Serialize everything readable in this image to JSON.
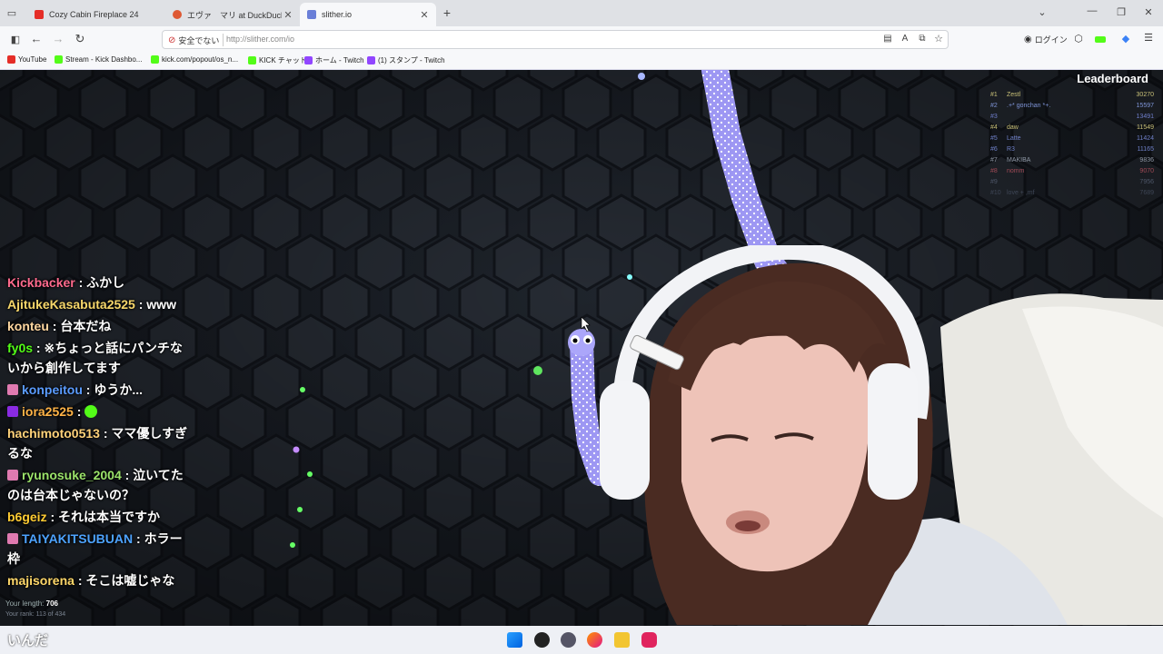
{
  "browser": {
    "tabs": [
      {
        "title": "Cozy Cabin Fireplace 24",
        "favicon": "youtube-icon",
        "color": "#e52d27",
        "active": false
      },
      {
        "title": "エヴァ　マリ at DuckDuckGo",
        "favicon": "duckduckgo-icon",
        "color": "#de5833",
        "active": false
      },
      {
        "title": "slither.io",
        "favicon": "slither-icon",
        "color": "#6a7fd8",
        "active": true
      }
    ],
    "new_tab": "+",
    "insecure_label": "安全でない",
    "url": "http://slither.com/io",
    "login_label": "ログイン",
    "bookmarks": [
      {
        "label": "YouTube",
        "icon": "youtube-icon",
        "color": "#e52d27"
      },
      {
        "label": "Stream - Kick Dashbo...",
        "icon": "kick-icon",
        "color": "#53fc18"
      },
      {
        "label": "kick.com/popout/os_n...",
        "icon": "kick-icon",
        "color": "#53fc18"
      },
      {
        "label": "KICK チャット",
        "icon": "kick-icon",
        "color": "#53fc18"
      },
      {
        "label": "ホーム - Twitch",
        "icon": "twitch-icon",
        "color": "#9146ff"
      },
      {
        "label": "(1) スタンプ - Twitch",
        "icon": "twitch-icon",
        "color": "#9146ff"
      }
    ]
  },
  "leaderboard": {
    "title": "Leaderboard",
    "entries": [
      {
        "rank": "#1",
        "name": "Zestl",
        "score": "30270",
        "color": "#c9c078"
      },
      {
        "rank": "#2",
        "name": ".+* gonchan *+.",
        "score": "15597",
        "color": "#7f95d8"
      },
      {
        "rank": "#3",
        "name": "",
        "score": "13491",
        "color": "#6f7ecb"
      },
      {
        "rank": "#4",
        "name": "daw",
        "score": "11549",
        "color": "#c9c078"
      },
      {
        "rank": "#5",
        "name": "Latte",
        "score": "11424",
        "color": "#6f80c8"
      },
      {
        "rank": "#6",
        "name": "R3",
        "score": "11165",
        "color": "#6f80c8"
      },
      {
        "rank": "#7",
        "name": "MAKIBA",
        "score": "9836",
        "color": "#8d95a3"
      },
      {
        "rank": "#8",
        "name": "nomm",
        "score": "9070",
        "color": "#a04a56"
      },
      {
        "rank": "#9",
        "name": "",
        "score": "7956",
        "color": "#4d5668"
      },
      {
        "rank": "#10",
        "name": "love + ,mf",
        "score": "7689",
        "color": "#3e4656"
      }
    ]
  },
  "stats": {
    "length_label": "Your length:",
    "length_value": "706",
    "rank_text": "Your rank: 113 of 434"
  },
  "chat": [
    {
      "user": "Kickbacker",
      "text": "ふかし",
      "color": "#ff6a8d",
      "badge": null
    },
    {
      "user": "AjitukeKasabuta2525",
      "text": "www",
      "color": "#f7d76b",
      "badge": null
    },
    {
      "user": "konteu",
      "text": "台本だね",
      "color": "#ffd7a0",
      "badge": null
    },
    {
      "user": "fy0s",
      "text": "※ちょっと話にパンチないから創作してます",
      "color": "#53fc18",
      "badge": null
    },
    {
      "user": "konpeitou",
      "text": "ゆうか...",
      "color": "#5b9cff",
      "badge": "#e07ab0"
    },
    {
      "user": "iora2525",
      "text": "",
      "color": "#ffb347",
      "badge": "#8a2be2"
    },
    {
      "user": "hachimoto0513",
      "text": "ママ優しすぎるな",
      "color": "#ffd27a",
      "badge": null
    },
    {
      "user": "ryunosuke_2004",
      "text": "泣いてたのは台本じゃないの？",
      "color": "#9be36a",
      "badge": "#e07ab0"
    },
    {
      "user": "b6geiz",
      "text": "それは本当ですか",
      "color": "#ffcc33",
      "badge": null
    },
    {
      "user": "TAIYAKITSUBUAN",
      "text": "ホラー枠",
      "color": "#4da3ff",
      "badge": "#e07ab0"
    },
    {
      "user": "majisorena",
      "text": "そこは嘘じゃな",
      "color": "#ffd86a",
      "badge": null
    }
  ],
  "bottom_text": "いんだ",
  "colors": {
    "background": "#171b22",
    "hex": "#262b33",
    "snake": "#b9b6ff",
    "accent": "#53fc18"
  }
}
